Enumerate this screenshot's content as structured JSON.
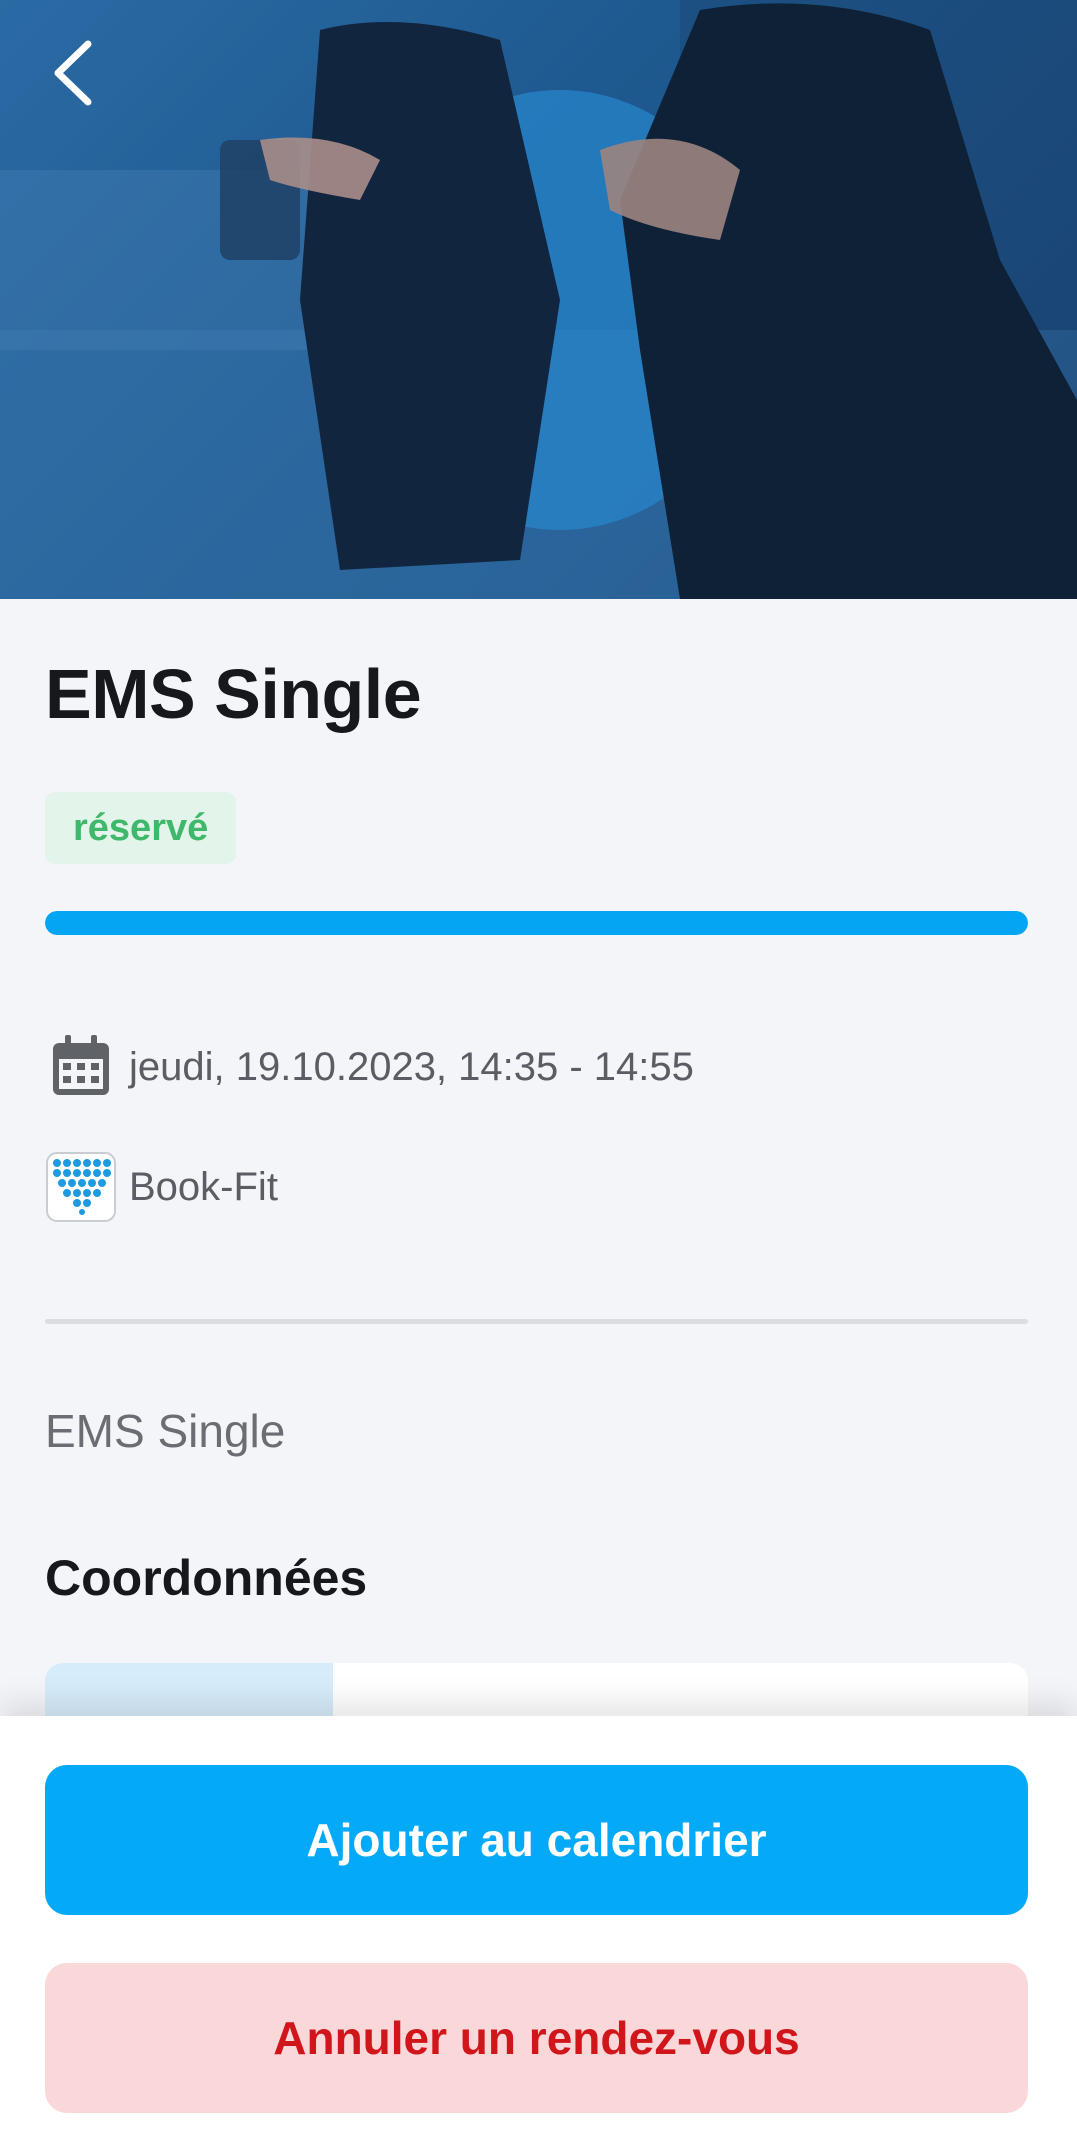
{
  "header": {
    "back_icon": "chevron-left-icon"
  },
  "event": {
    "title": "EMS Single",
    "status_badge": "réservé",
    "status_color": "#3fb86c",
    "progress_fraction": 1.0,
    "datetime": "jeudi, 19.10.2023, 14:35 - 14:55",
    "datetime_icon": "calendar-icon",
    "provider": "Book-Fit",
    "provider_icon": "book-fit-logo-icon",
    "description": "EMS Single"
  },
  "contact": {
    "heading": "Coordonnées"
  },
  "actions": {
    "add_calendar_label": "Ajouter au calendrier",
    "cancel_label": "Annuler un rendez-vous"
  },
  "colors": {
    "accent": "#04a9f8",
    "danger": "#d0161b",
    "danger_bg": "#fad7d9"
  }
}
